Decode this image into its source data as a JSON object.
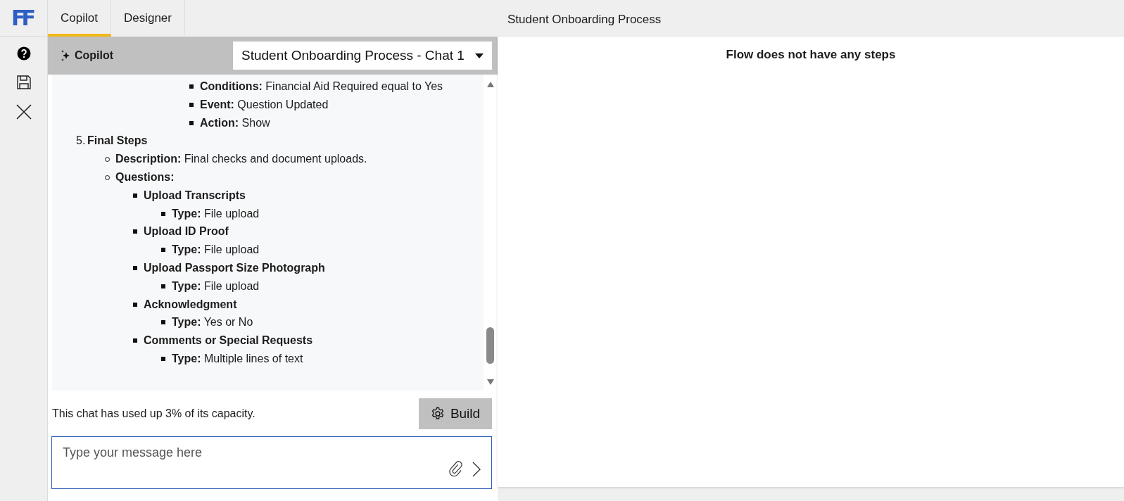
{
  "app": {
    "logo": "FF"
  },
  "tabs": [
    {
      "label": "Copilot",
      "selected": true
    },
    {
      "label": "Designer",
      "selected": false
    }
  ],
  "flow_title": "Student Onboarding Process",
  "copilot": {
    "title": "Copilot",
    "chat_select": "Student Onboarding Process - Chat 1",
    "items": [
      {
        "kind": "group",
        "children": [
          {
            "kind": "group",
            "children": [
              {
                "kind": "group",
                "children": [
                  {
                    "kind": "group",
                    "children": [
                      {
                        "kind": "square",
                        "label": "Conditions:",
                        "value": "Financial Aid Required equal to Yes"
                      },
                      {
                        "kind": "square",
                        "label": "Event:",
                        "value": "Question Updated"
                      },
                      {
                        "kind": "square",
                        "label": "Action:",
                        "value": "Show"
                      }
                    ]
                  }
                ]
              }
            ]
          }
        ]
      },
      {
        "kind": "number",
        "number": "5.",
        "label": "Final Steps",
        "children": [
          {
            "kind": "circle",
            "label": "Description:",
            "value": "Final checks and document uploads."
          },
          {
            "kind": "circle",
            "label": "Questions:",
            "children": [
              {
                "kind": "square",
                "label": "Upload Transcripts",
                "children": [
                  {
                    "kind": "square",
                    "label": "Type:",
                    "value": "File upload"
                  }
                ]
              },
              {
                "kind": "square",
                "label": "Upload ID Proof",
                "children": [
                  {
                    "kind": "square",
                    "label": "Type:",
                    "value": "File upload"
                  }
                ]
              },
              {
                "kind": "square",
                "label": "Upload Passport Size Photograph",
                "children": [
                  {
                    "kind": "square",
                    "label": "Type:",
                    "value": "File upload"
                  }
                ]
              },
              {
                "kind": "square",
                "label": "Acknowledgment",
                "children": [
                  {
                    "kind": "square",
                    "label": "Type:",
                    "value": "Yes or No"
                  }
                ]
              },
              {
                "kind": "square",
                "label": "Comments or Special Requests",
                "children": [
                  {
                    "kind": "square",
                    "label": "Type:",
                    "value": "Multiple lines of text"
                  }
                ]
              }
            ]
          }
        ]
      }
    ],
    "capacity": "This chat has used up 3% of its capacity.",
    "build_button": "Build",
    "message": {
      "placeholder": "Type your message here"
    }
  },
  "flow": {
    "empty_message": "Flow does not have any steps"
  }
}
